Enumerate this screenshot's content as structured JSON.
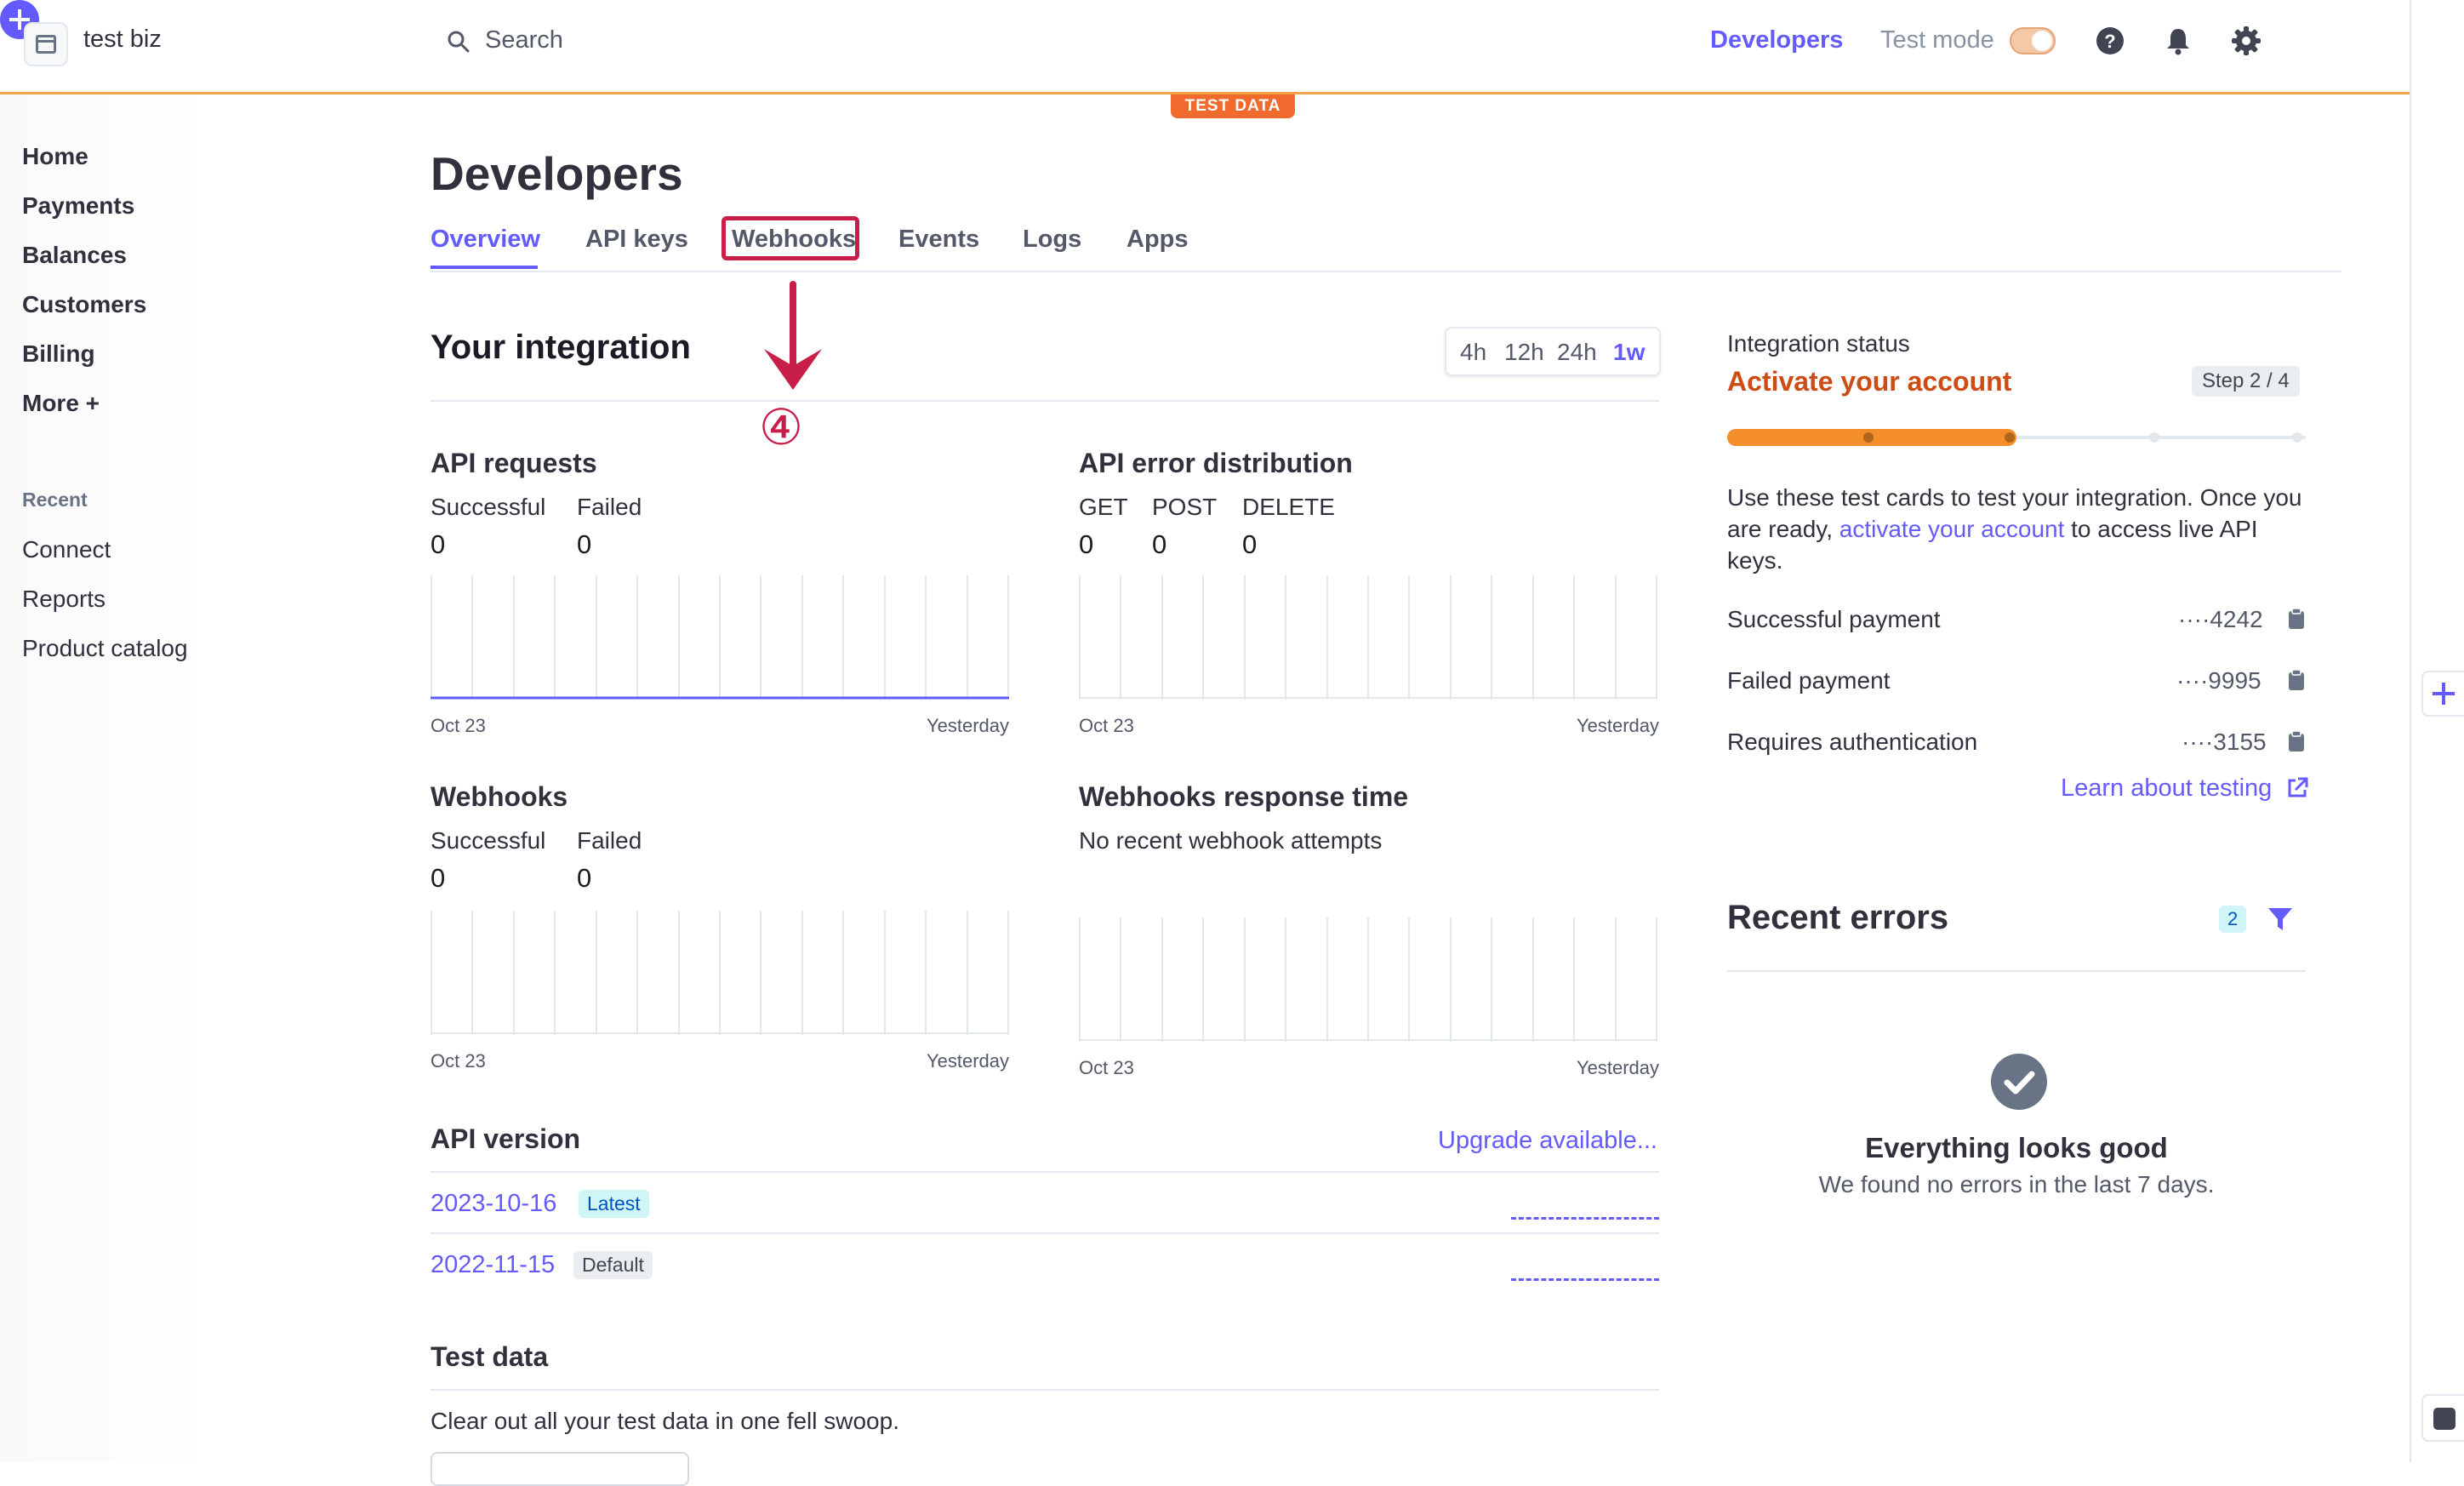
{
  "header": {
    "business_name": "test biz",
    "search_placeholder": "Search",
    "developers_label": "Developers",
    "test_mode_label": "Test mode",
    "test_mode_on": true,
    "test_data_badge": "TEST DATA"
  },
  "sidebar": {
    "items": [
      {
        "label": "Home"
      },
      {
        "label": "Payments"
      },
      {
        "label": "Balances"
      },
      {
        "label": "Customers"
      },
      {
        "label": "Billing"
      },
      {
        "label": "More +"
      }
    ],
    "recent_heading": "Recent",
    "recent_items": [
      {
        "label": "Connect"
      },
      {
        "label": "Reports"
      },
      {
        "label": "Product catalog"
      }
    ]
  },
  "page": {
    "title": "Developers",
    "tabs": [
      {
        "label": "Overview",
        "active": true
      },
      {
        "label": "API keys"
      },
      {
        "label": "Webhooks",
        "highlighted": true
      },
      {
        "label": "Events"
      },
      {
        "label": "Logs"
      },
      {
        "label": "Apps"
      }
    ],
    "annotation_number": "④"
  },
  "integration": {
    "title": "Your integration",
    "ranges": [
      "4h",
      "12h",
      "24h",
      "1w"
    ],
    "selected_range": "1w",
    "cards": {
      "api_requests": {
        "title": "API requests",
        "metrics": [
          {
            "label": "Successful",
            "value": "0"
          },
          {
            "label": "Failed",
            "value": "0"
          }
        ],
        "start": "Oct 23",
        "end": "Yesterday"
      },
      "api_errors": {
        "title": "API error distribution",
        "metrics": [
          {
            "label": "GET",
            "value": "0"
          },
          {
            "label": "POST",
            "value": "0"
          },
          {
            "label": "DELETE",
            "value": "0"
          }
        ],
        "start": "Oct 23",
        "end": "Yesterday"
      },
      "webhooks": {
        "title": "Webhooks",
        "metrics": [
          {
            "label": "Successful",
            "value": "0"
          },
          {
            "label": "Failed",
            "value": "0"
          }
        ],
        "start": "Oct 23",
        "end": "Yesterday"
      },
      "webhook_time": {
        "title": "Webhooks response time",
        "note": "No recent webhook attempts",
        "start": "Oct 23",
        "end": "Yesterday"
      }
    }
  },
  "api_version": {
    "title": "API version",
    "upgrade_label": "Upgrade available...",
    "versions": [
      {
        "version": "2023-10-16",
        "badge": "Latest"
      },
      {
        "version": "2022-11-15",
        "badge": "Default"
      }
    ]
  },
  "test_data": {
    "title": "Test data",
    "description": "Clear out all your test data in one fell swoop."
  },
  "status": {
    "label": "Integration status",
    "title": "Activate your account",
    "step": "Step 2 / 4",
    "progress_fraction": 0.5,
    "desc_before": "Use these test cards to test your integration. Once you are ready, ",
    "desc_link": "activate your account",
    "desc_after": " to access live API keys.",
    "cards": [
      {
        "label": "Successful payment",
        "number": "····4242"
      },
      {
        "label": "Failed payment",
        "number": "····9995"
      },
      {
        "label": "Requires authentication",
        "number": "····3155"
      }
    ],
    "learn_label": "Learn about testing"
  },
  "errors": {
    "title": "Recent errors",
    "count": "2",
    "empty_title": "Everything looks good",
    "empty_desc": "We found no errors in the last 7 days."
  },
  "colors": {
    "accent": "#635bff",
    "warning": "#cc4c14",
    "progress": "#f48e2a",
    "annotation": "#c81e4a"
  }
}
